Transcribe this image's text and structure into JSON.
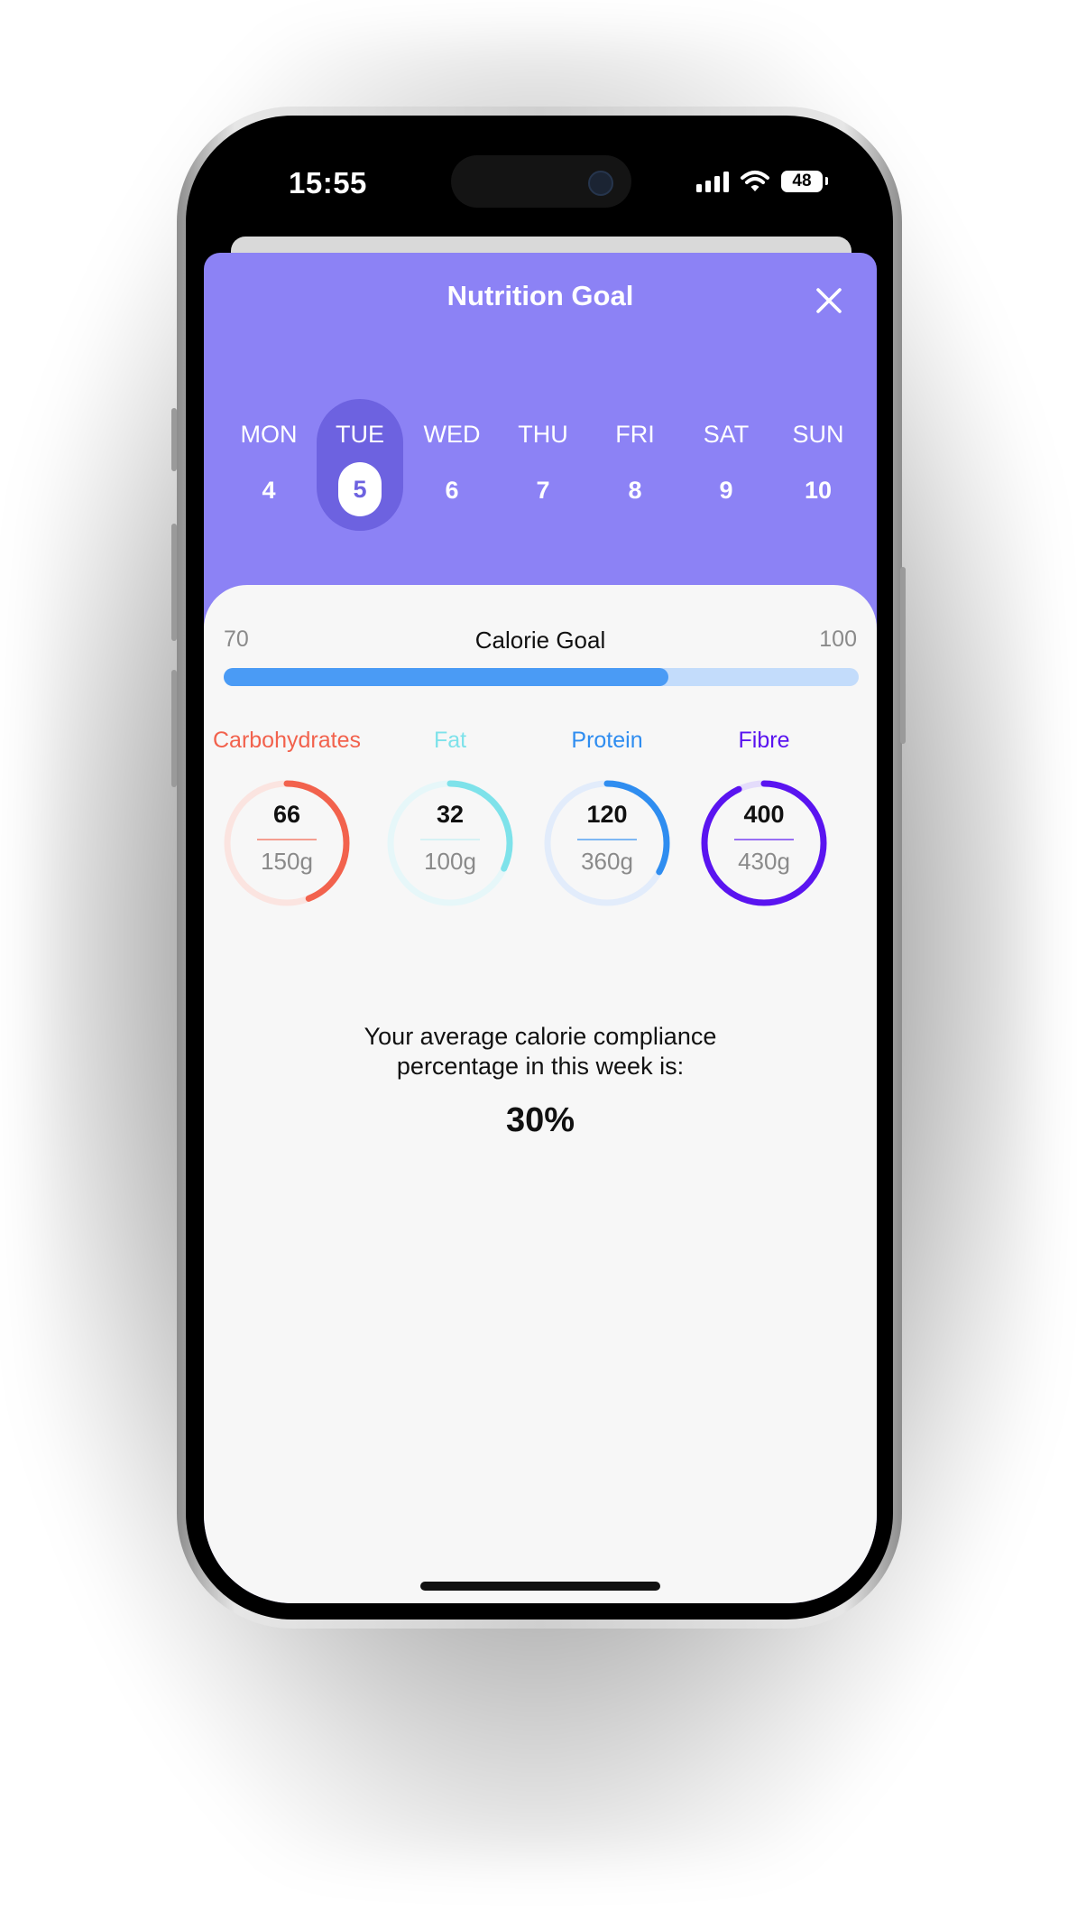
{
  "status_bar": {
    "time": "15:55",
    "battery": "48"
  },
  "header": {
    "title": "Nutrition Goal",
    "background_color": "#8c82f5",
    "close_icon": "close-icon"
  },
  "days": [
    {
      "name": "MON",
      "date": "4",
      "selected": false
    },
    {
      "name": "TUE",
      "date": "5",
      "selected": true
    },
    {
      "name": "WED",
      "date": "6",
      "selected": false
    },
    {
      "name": "THU",
      "date": "7",
      "selected": false
    },
    {
      "name": "FRI",
      "date": "8",
      "selected": false
    },
    {
      "name": "SAT",
      "date": "9",
      "selected": false
    },
    {
      "name": "SUN",
      "date": "10",
      "selected": false
    }
  ],
  "calorie_goal": {
    "title": "Calorie Goal",
    "min_label": "70",
    "max_label": "100",
    "progress": 0.7,
    "fill_color": "#4a9bf5",
    "track_color": "#c3dcfb"
  },
  "macros": [
    {
      "name": "Carbohydrates",
      "current": "66",
      "goal": "150g",
      "progress": 0.44,
      "color": "#f2624d",
      "track": "#fbe4e0"
    },
    {
      "name": "Fat",
      "current": "32",
      "goal": "100g",
      "progress": 0.32,
      "color": "#7ee2ea",
      "track": "#e6f7f9"
    },
    {
      "name": "Protein",
      "current": "120",
      "goal": "360g",
      "progress": 0.33,
      "color": "#2f8df0",
      "track": "#e2ecfb"
    },
    {
      "name": "Fibre",
      "current": "400",
      "goal": "430g",
      "progress": 0.93,
      "color": "#5a14f0",
      "track": "#e4dcfb"
    }
  ],
  "summary": {
    "line1": "Your average calorie compliance",
    "line2": "percentage in this week is:",
    "value": "30%"
  }
}
